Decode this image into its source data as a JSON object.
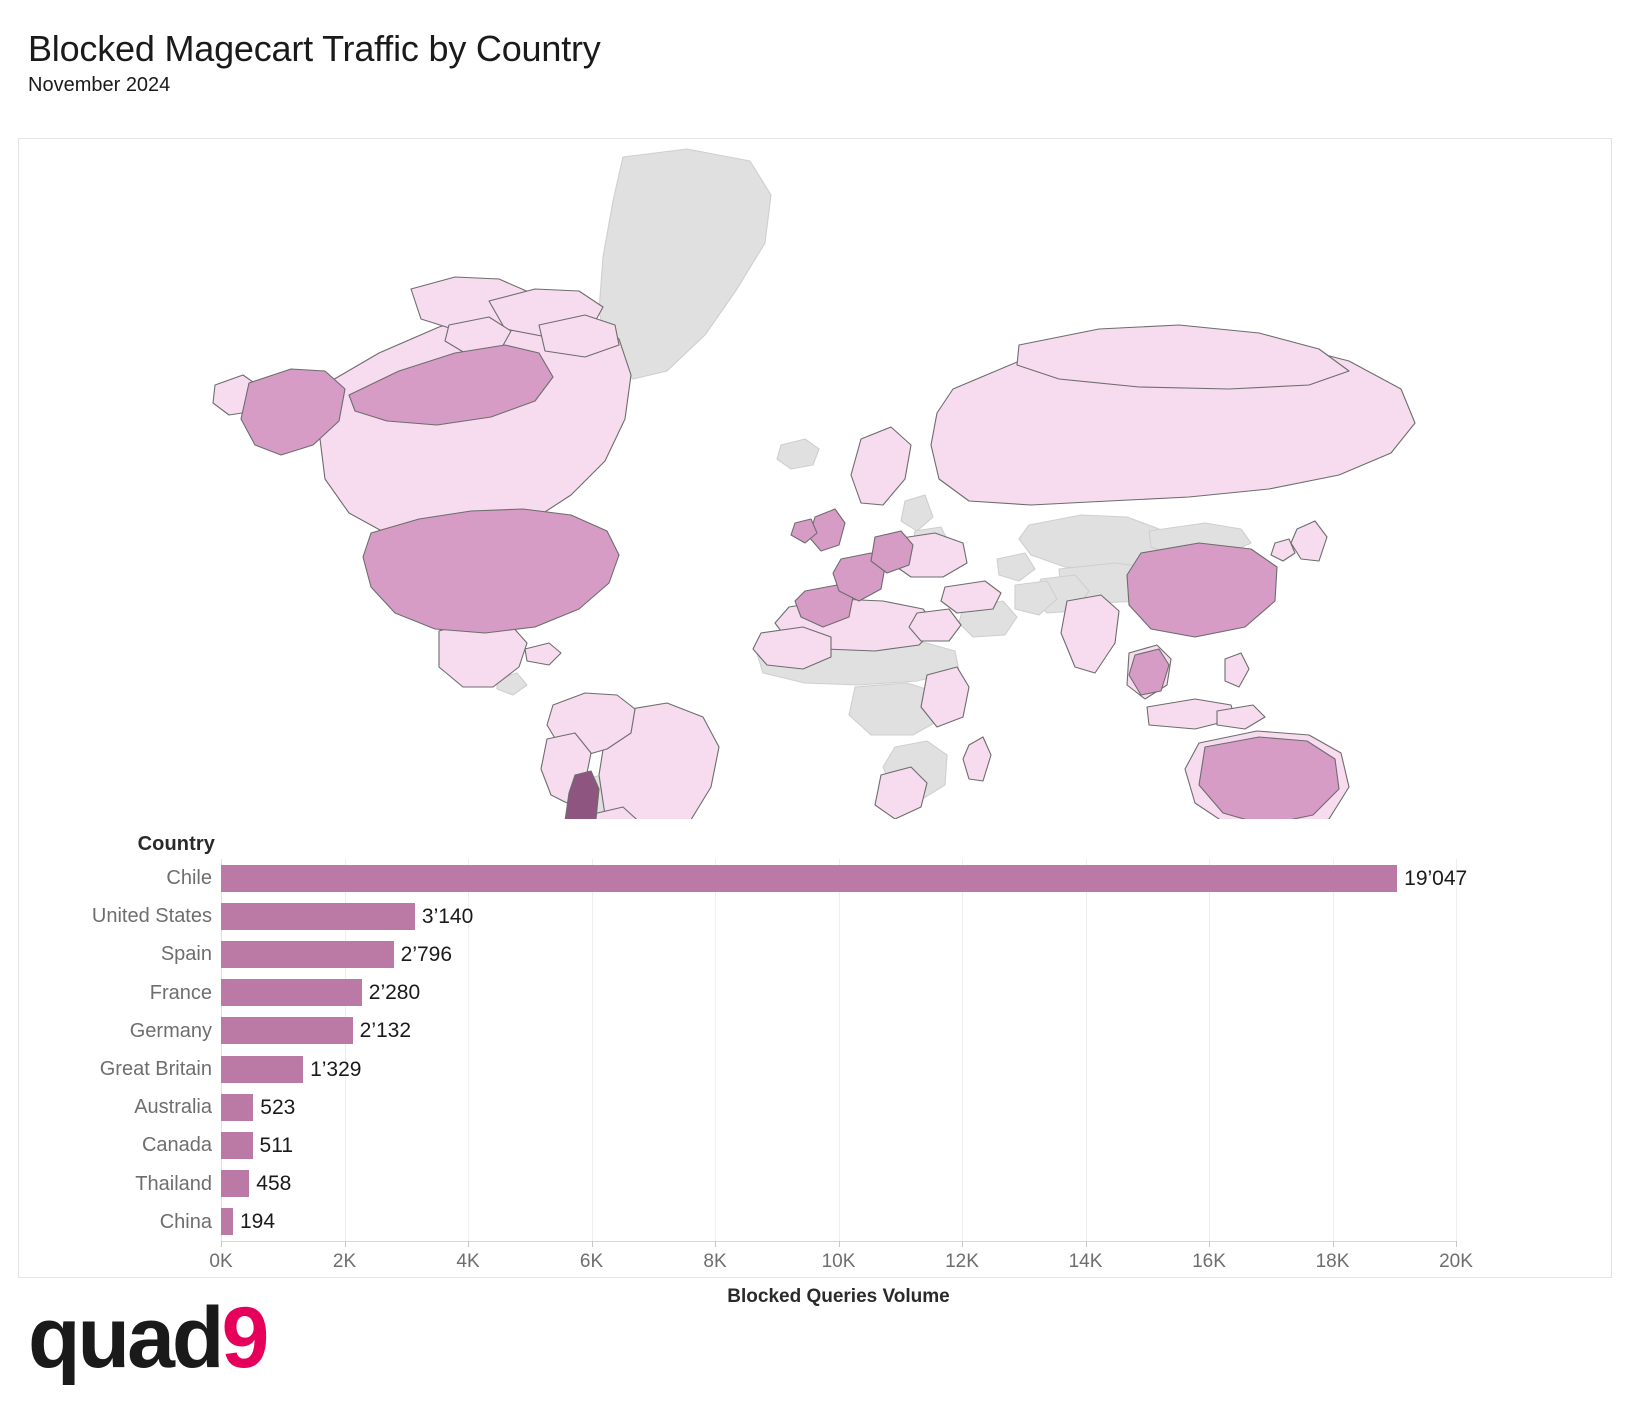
{
  "header": {
    "title": "Blocked Magecart Traffic by Country",
    "subtitle": "November 2024"
  },
  "logo": {
    "text_dark": "quad",
    "text_accent": "9"
  },
  "colors": {
    "bar": "#bb7aa6",
    "map_max": "#8e5580",
    "map_mid": "#cf94bd",
    "map_low": "#f4d8ea",
    "map_nodata": "#e0e0e0",
    "logo_accent": "#e6005c"
  },
  "chart_data": {
    "type": "bar",
    "orientation": "horizontal",
    "title": "Blocked Magecart Traffic by Country",
    "subtitle": "November 2024",
    "ylabel": "Country",
    "xlabel": "Blocked Queries Volume",
    "xlim": [
      0,
      20000
    ],
    "grid": true,
    "legend": "none",
    "tick_labels": [
      "0K",
      "2K",
      "4K",
      "6K",
      "8K",
      "10K",
      "12K",
      "14K",
      "16K",
      "18K",
      "20K"
    ],
    "tick_values": [
      0,
      2000,
      4000,
      6000,
      8000,
      10000,
      12000,
      14000,
      16000,
      18000,
      20000
    ],
    "categories": [
      "Chile",
      "United States",
      "Spain",
      "France",
      "Germany",
      "Great Britain",
      "Australia",
      "Canada",
      "Thailand",
      "China"
    ],
    "values": [
      19047,
      3140,
      2796,
      2280,
      2132,
      1329,
      523,
      511,
      458,
      194
    ],
    "value_labels": [
      "19’047",
      "3’140",
      "2’796",
      "2’280",
      "2’132",
      "1’329",
      "523",
      "511",
      "458",
      "194"
    ],
    "rows": [
      {
        "label": "Chile",
        "value": 19047,
        "value_label": "19’047"
      },
      {
        "label": "United States",
        "value": 3140,
        "value_label": "3’140"
      },
      {
        "label": "Spain",
        "value": 2796,
        "value_label": "2’796"
      },
      {
        "label": "France",
        "value": 2280,
        "value_label": "2’280"
      },
      {
        "label": "Germany",
        "value": 2132,
        "value_label": "2’132"
      },
      {
        "label": "Great Britain",
        "value": 1329,
        "value_label": "1’329"
      },
      {
        "label": "Australia",
        "value": 523,
        "value_label": "523"
      },
      {
        "label": "Canada",
        "value": 511,
        "value_label": "511"
      },
      {
        "label": "Thailand",
        "value": 458,
        "value_label": "458"
      },
      {
        "label": "China",
        "value": 194,
        "value_label": "194"
      }
    ],
    "map": {
      "type": "choropleth",
      "description": "World choropleth of blocked Magecart queries; darkest shade is Chile, lighter pinks for reporting countries, grey for countries with no data."
    }
  }
}
